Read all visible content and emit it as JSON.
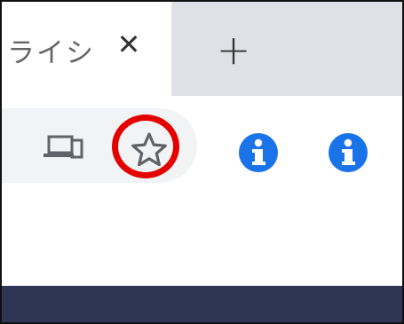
{
  "tabs": {
    "active_title": "ライシ",
    "close_symbol": "✕",
    "new_tab_symbol": "+"
  },
  "toolbar": {
    "icons": {
      "device": "devices-icon",
      "star": "star-icon",
      "extension_1": "info-icon",
      "extension_2": "info-icon"
    }
  },
  "colors": {
    "tabstrip": "#dee1e6",
    "omnibox": "#f1f3f4",
    "highlight": "#e50000",
    "extension": "#1a73e8",
    "bottom_bar": "#2f3554"
  }
}
